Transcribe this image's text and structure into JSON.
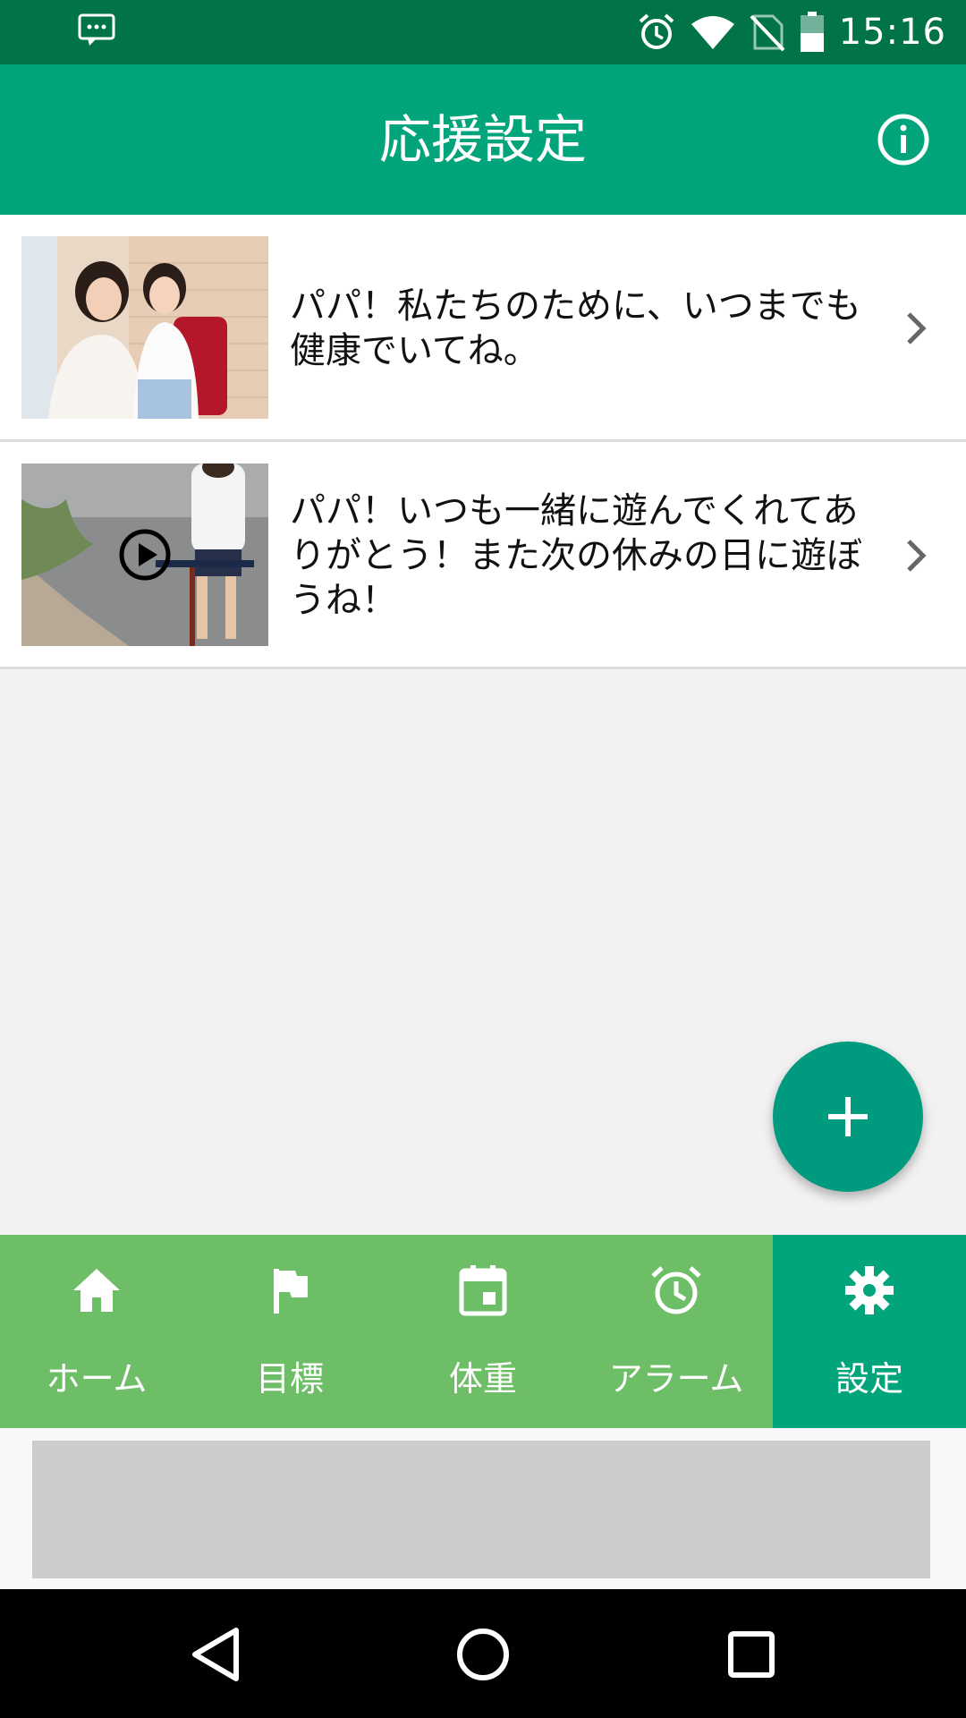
{
  "status_bar": {
    "time": "15:16",
    "icons": [
      "message-icon",
      "alarm-icon",
      "wifi-icon",
      "no-sim-icon",
      "battery-icon"
    ]
  },
  "app_bar": {
    "title": "応援設定",
    "action_icon": "info-icon"
  },
  "list": {
    "items": [
      {
        "text": "パパ！私たちのために、いつまでも健康でいてね。",
        "media": "photo",
        "has_play": false
      },
      {
        "text": "パパ！いつも一緒に遊んでくれてありがとう！また次の休みの日に遊ぼうね！",
        "media": "video",
        "has_play": true
      }
    ]
  },
  "fab": {
    "label": "+",
    "icon": "add-icon"
  },
  "bottom_nav": {
    "items": [
      {
        "label": "ホーム",
        "icon": "home-icon",
        "active": false
      },
      {
        "label": "目標",
        "icon": "flag-icon",
        "active": false
      },
      {
        "label": "体重",
        "icon": "calendar-icon",
        "active": false
      },
      {
        "label": "アラーム",
        "icon": "alarm-icon",
        "active": false
      },
      {
        "label": "設定",
        "icon": "gear-icon",
        "active": true
      }
    ]
  },
  "colors": {
    "status_bar": "#007347",
    "app_bar": "#02a47c",
    "nav_bar": "#6dbe66",
    "nav_active": "#02a47c",
    "fab": "#009a7e"
  }
}
